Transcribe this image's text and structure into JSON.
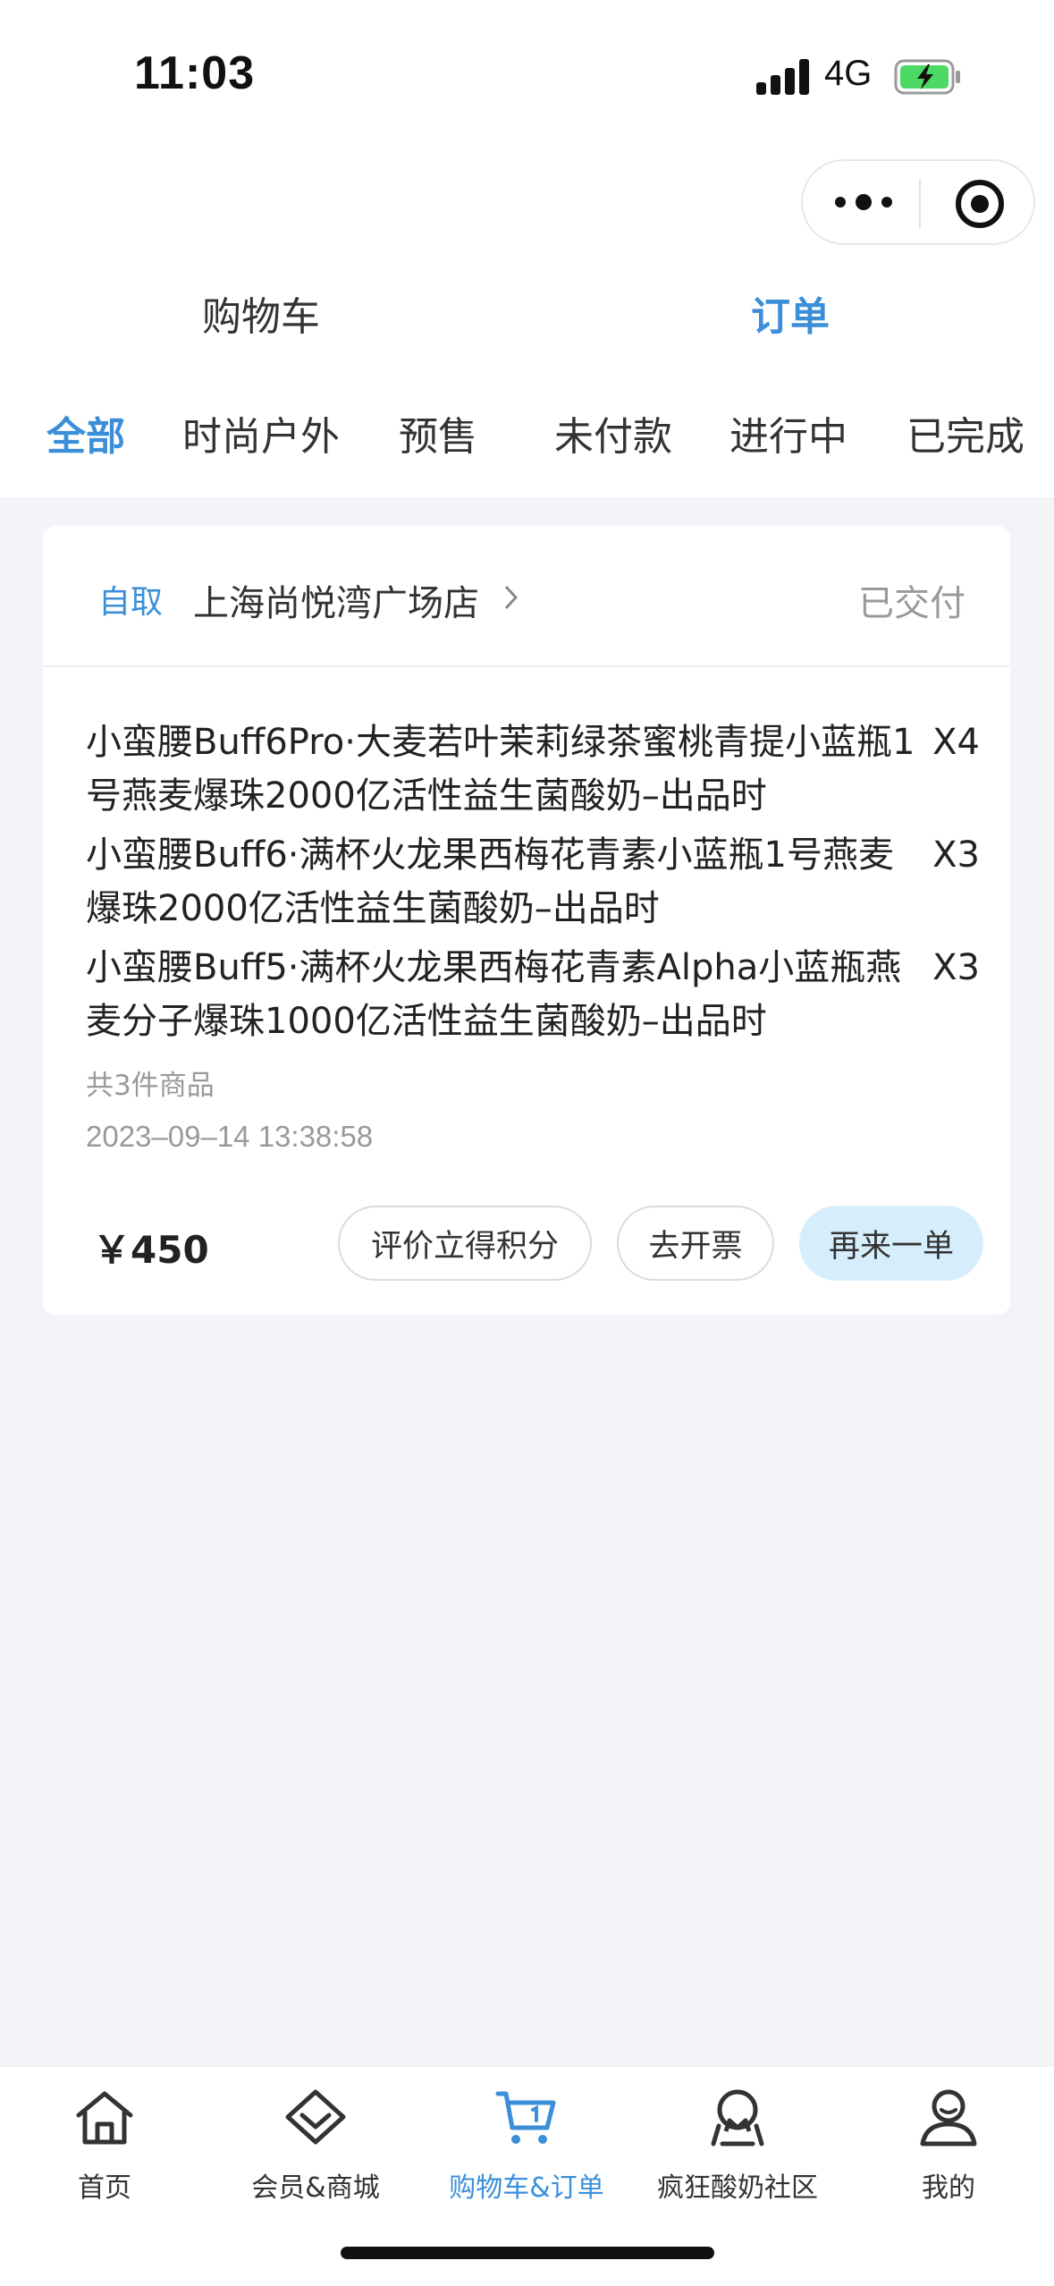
{
  "status_bar": {
    "time": "11:03",
    "network": "4G",
    "icons": [
      "signal-icon",
      "battery-charging-icon"
    ]
  },
  "capsule": {
    "icons": [
      "more-icon",
      "target-icon"
    ]
  },
  "main_tabs": [
    {
      "label": "购物车",
      "active": false
    },
    {
      "label": "订单",
      "active": true
    }
  ],
  "sub_tabs": [
    {
      "label": "全部",
      "active": true
    },
    {
      "label": "时尚户外",
      "active": false
    },
    {
      "label": "预售",
      "active": false
    },
    {
      "label": "未付款",
      "active": false
    },
    {
      "label": "进行中",
      "active": false
    },
    {
      "label": "已完成",
      "active": false
    }
  ],
  "order": {
    "pickup_label": "自取",
    "store": "上海尚悦湾广场店",
    "status": "已交付",
    "items": [
      {
        "name": "小蛮腰Buff6Pro·大麦若叶茉莉绿茶蜜桃青提小蓝瓶1号燕麦爆珠2000亿活性益生菌酸奶–出品时",
        "qty": "X4"
      },
      {
        "name": "小蛮腰Buff6·满杯火龙果西梅花青素小蓝瓶1号燕麦爆珠2000亿活性益生菌酸奶–出品时",
        "qty": "X3"
      },
      {
        "name": "小蛮腰Buff5·满杯火龙果西梅花青素Alpha小蓝瓶燕麦分子爆珠1000亿活性益生菌酸奶–出品时",
        "qty": "X3"
      }
    ],
    "count_text": "共3件商品",
    "datetime": "2023–09–14 13:38:58",
    "price": "￥450",
    "buttons": {
      "review": "评价立得积分",
      "invoice": "去开票",
      "reorder": "再来一单"
    }
  },
  "bottom_nav": [
    {
      "label": "首页",
      "icon": "home-icon",
      "active": false
    },
    {
      "label": "会员&商城",
      "icon": "diamond-icon",
      "active": false
    },
    {
      "label": "购物车&订单",
      "icon": "cart-icon",
      "active": true
    },
    {
      "label": "疯狂酸奶社区",
      "icon": "community-icon",
      "active": false
    },
    {
      "label": "我的",
      "icon": "profile-icon",
      "active": false
    }
  ],
  "colors": {
    "accent": "#3b8fd9",
    "page_bg": "#f2f4f8",
    "reorder_bg": "#d6eefc",
    "muted_text": "#999999"
  }
}
